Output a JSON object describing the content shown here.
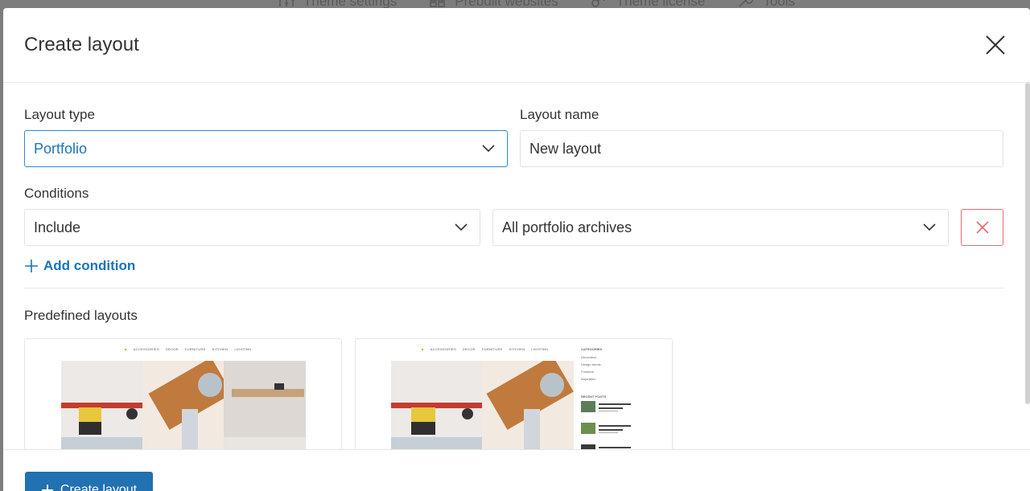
{
  "background_toolbar": {
    "items": [
      {
        "label": "Theme settings",
        "icon": "sliders-icon"
      },
      {
        "label": "Prebuilt websites",
        "icon": "grid-icon"
      },
      {
        "label": "Theme license",
        "icon": "key-icon"
      },
      {
        "label": "Tools",
        "icon": "wrench-icon"
      }
    ]
  },
  "modal": {
    "title": "Create layout",
    "layout_type_label": "Layout type",
    "layout_type_value": "Portfolio",
    "layout_name_label": "Layout name",
    "layout_name_value": "New layout",
    "conditions_label": "Conditions",
    "condition_mode": "Include",
    "condition_target": "All portfolio archives",
    "add_condition_label": "Add condition",
    "predefined_label": "Predefined layouts",
    "create_button_label": "Create layout"
  },
  "thumbnails": {
    "nav": [
      "ACCESSORIES",
      "DECOR",
      "FURNITURE",
      "KITCHEN",
      "LIGHTING"
    ],
    "sidebar_heading": "CATEGORIES",
    "sidebar_categories": [
      "Decoration",
      "Design trends",
      "Furniture",
      "Inspiration"
    ],
    "recent_heading": "RECENT POSTS"
  },
  "colors": {
    "accent": "#2271b1",
    "link": "#1a73b8",
    "focus_border": "#2b8ad2",
    "danger": "#e46d6d"
  }
}
